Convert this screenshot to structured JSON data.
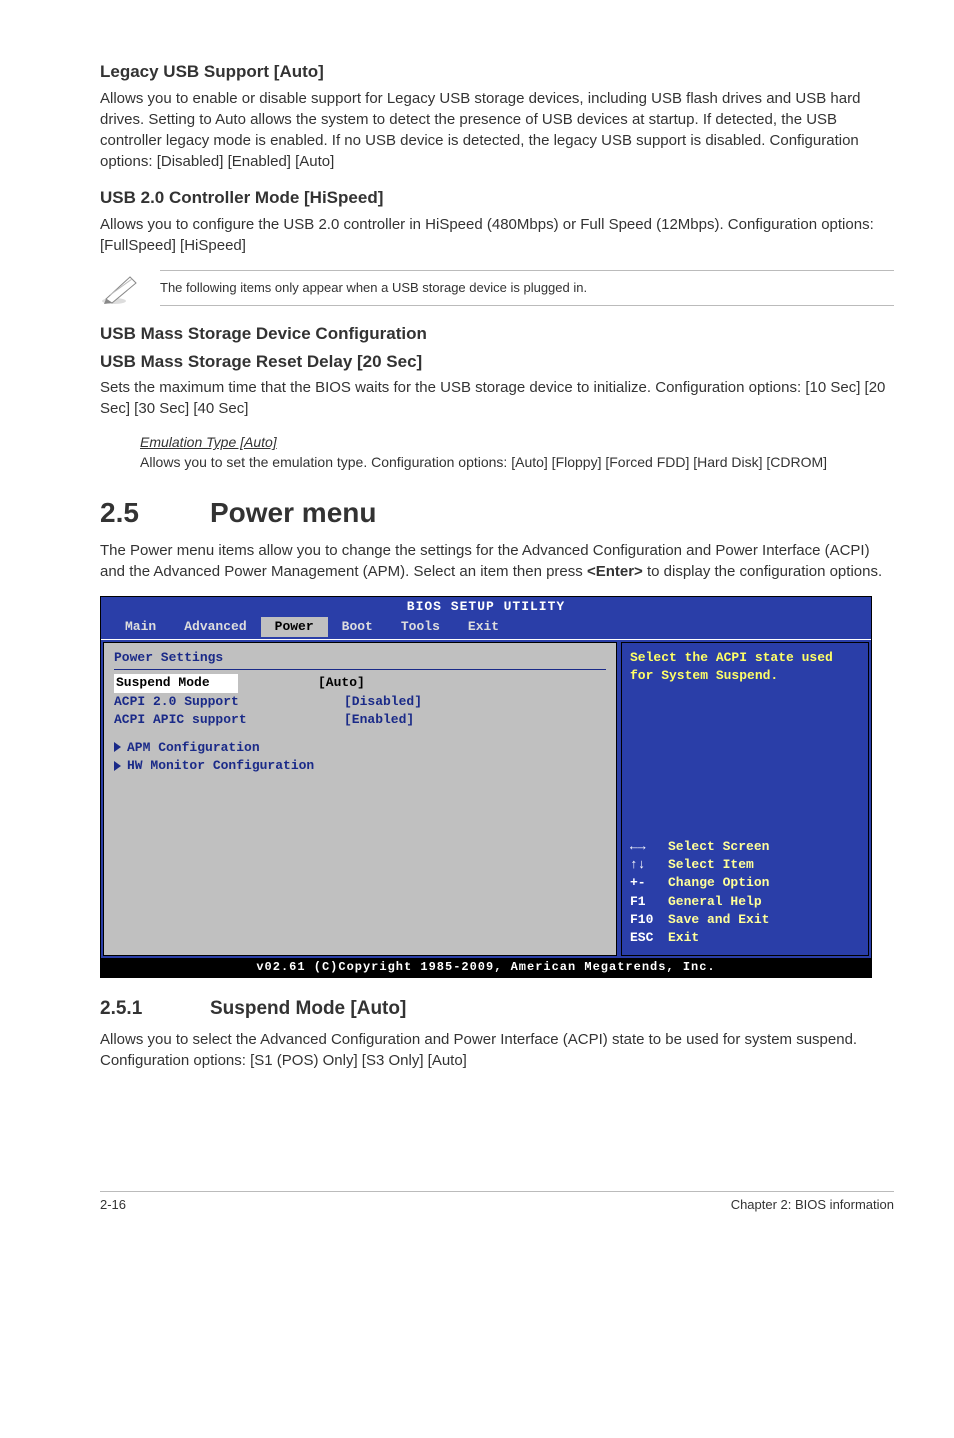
{
  "s1": {
    "h": "Legacy USB Support [Auto]",
    "p": "Allows you to enable or disable support for Legacy USB storage devices, including USB flash drives and USB hard drives. Setting to Auto allows the system to detect the presence of USB devices at startup. If detected, the USB controller legacy mode is enabled. If no USB device is detected, the legacy USB support is disabled. Configuration options: [Disabled] [Enabled] [Auto]"
  },
  "s2": {
    "h": "USB 2.0 Controller Mode [HiSpeed]",
    "p": "Allows you to configure the USB 2.0 controller in HiSpeed (480Mbps) or Full Speed (12Mbps). Configuration options: [FullSpeed] [HiSpeed]"
  },
  "note": "The following items only appear when a USB storage device is plugged in.",
  "s3": {
    "h": "USB Mass Storage Device Configuration"
  },
  "s4": {
    "h": "USB Mass Storage Reset Delay [20 Sec]",
    "p": "Sets the maximum time that the BIOS waits for the USB storage device to initialize. Configuration options: [10 Sec] [20 Sec] [30 Sec] [40 Sec]"
  },
  "emul": {
    "t": "Emulation Type [Auto]",
    "p": "Allows you to set the emulation type. Configuration options: [Auto] [Floppy] [Forced FDD] [Hard Disk] [CDROM]"
  },
  "power": {
    "num": "2.5",
    "title": "Power menu",
    "p": "The Power menu items allow you to change the settings for the Advanced Configuration and Power Interface (ACPI) and the Advanced Power Management (APM). Select an item then press <Enter> to display the configuration options."
  },
  "bios": {
    "title": "BIOS SETUP UTILITY",
    "tabs": [
      "Main",
      "Advanced",
      "Power",
      "Boot",
      "Tools",
      "Exit"
    ],
    "active_tab": 2,
    "left_title": "Power Settings",
    "rows": [
      {
        "label": "Suspend Mode",
        "value": "[Auto]",
        "selected": true
      },
      {
        "label": "ACPI 2.0 Support",
        "value": "[Disabled]"
      },
      {
        "label": "ACPI APIC support",
        "value": "[Enabled]"
      }
    ],
    "subs": [
      "APM Configuration",
      "HW Monitor Configuration"
    ],
    "help": "Select the ACPI state used for System Suspend.",
    "keys": [
      {
        "k": "←→",
        "d": "Select Screen"
      },
      {
        "k": "↑↓",
        "d": "Select Item"
      },
      {
        "k": "+-",
        "d": "Change Option"
      },
      {
        "k": "F1",
        "d": "General Help"
      },
      {
        "k": "F10",
        "d": "Save and Exit"
      },
      {
        "k": "ESC",
        "d": "Exit"
      }
    ],
    "footer": "v02.61 (C)Copyright 1985-2009, American Megatrends, Inc."
  },
  "suspend": {
    "num": "2.5.1",
    "title": "Suspend Mode [Auto]",
    "p": "Allows you to select the Advanced Configuration and Power Interface (ACPI) state to be used for system suspend. Configuration options: [S1 (POS) Only] [S3 Only] [Auto]"
  },
  "footer": {
    "left": "2-16",
    "right": "Chapter 2: BIOS information"
  }
}
